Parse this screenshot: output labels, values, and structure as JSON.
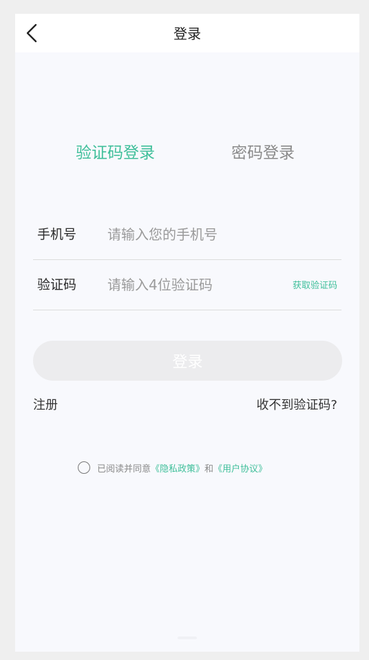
{
  "nav": {
    "title": "登录",
    "back_icon": "chevron-left-icon"
  },
  "tabs": [
    {
      "label": "验证码登录",
      "active": true
    },
    {
      "label": "密码登录",
      "active": false
    }
  ],
  "phone_field": {
    "label": "手机号",
    "placeholder": "请输入您的手机号",
    "value": ""
  },
  "code_field": {
    "label": "验证码",
    "placeholder": "请输入4位验证码",
    "value": "",
    "action_label": "获取验证码"
  },
  "login_button": {
    "label": "登录"
  },
  "links": {
    "register": "注册",
    "no_code": "收不到验证码?"
  },
  "agreement": {
    "prefix": "已阅读并同意",
    "privacy": "《隐私政策》",
    "and": "和",
    "terms": "《用户协议》",
    "checked": false
  },
  "colors": {
    "accent": "#3fbf9a",
    "background": "#f8f9fd",
    "button_disabled": "#ececee"
  }
}
